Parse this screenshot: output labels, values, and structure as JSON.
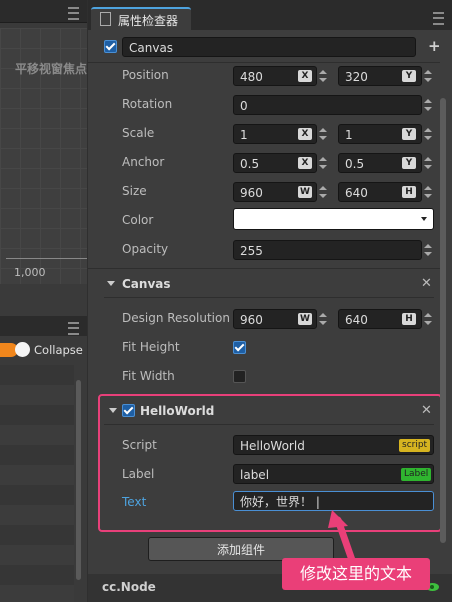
{
  "left_panel": {
    "scene_title": "平移视窗焦点",
    "axis_value": "1,000",
    "collapse_label": "Collapse"
  },
  "inspector": {
    "tab_label": "属性检查器",
    "node_name": "Canvas",
    "properties": {
      "position_label": "Position",
      "position_x": "480",
      "position_y": "320",
      "rotation_label": "Rotation",
      "rotation": "0",
      "scale_label": "Scale",
      "scale_x": "1",
      "scale_y": "1",
      "anchor_label": "Anchor",
      "anchor_x": "0.5",
      "anchor_y": "0.5",
      "size_label": "Size",
      "size_w": "960",
      "size_h": "640",
      "color_label": "Color",
      "color_value": "#ffffff",
      "opacity_label": "Opacity",
      "opacity": "255"
    },
    "axis_badges": {
      "x": "X",
      "y": "Y",
      "w": "W",
      "h": "H"
    },
    "canvas_component": {
      "title": "Canvas",
      "design_resolution_label": "Design Resolution",
      "design_w": "960",
      "design_h": "640",
      "fit_height_label": "Fit Height",
      "fit_height": true,
      "fit_width_label": "Fit Width",
      "fit_width": false
    },
    "helloworld_component": {
      "title": "HelloWorld",
      "enabled": true,
      "script_label": "Script",
      "script_value": "HelloWorld",
      "script_badge": "script",
      "label_label": "Label",
      "label_value": "label",
      "label_badge": "Label",
      "text_label": "Text",
      "text_value": "你好，世界！ |"
    },
    "add_component_label": "添加组件",
    "footer_label": "cc.Node"
  },
  "annotation": {
    "text": "修改这里的文本",
    "color": "#ea3f78"
  },
  "colors": {
    "accent_blue": "#4ea3df",
    "text_label_blue": "#4ea3df",
    "toggle_orange": "#f0861c",
    "script_badge": "#d6b420",
    "label_badge": "#2fb52f",
    "highlight_border": "#e8407a"
  }
}
